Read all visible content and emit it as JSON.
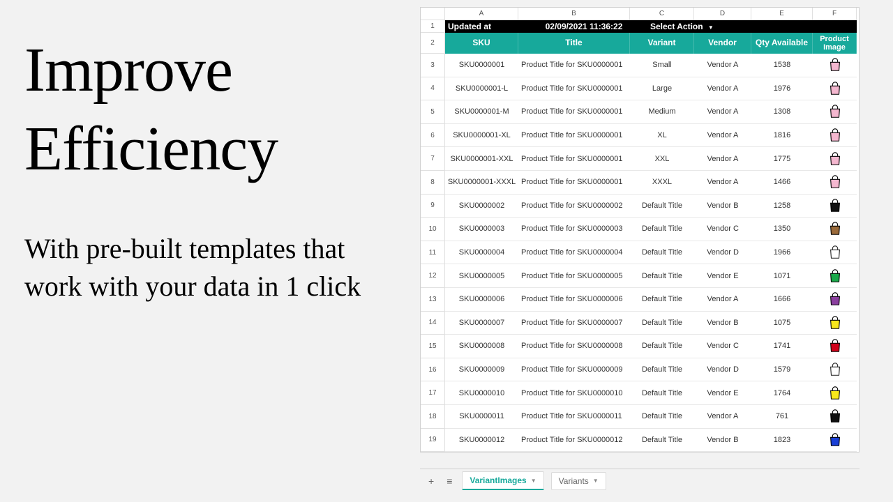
{
  "left": {
    "headline_l1": "Improve",
    "headline_l2": "Efficiency",
    "subhead": "With pre-built templates that work with your data in 1 click"
  },
  "blackbar": {
    "updated_label": "Updated at",
    "timestamp": "02/09/2021 11:36:22",
    "action_label": "Select Action"
  },
  "col_letters": [
    "",
    "A",
    "B",
    "C",
    "D",
    "E",
    "F"
  ],
  "headers": [
    "SKU",
    "Title",
    "Variant",
    "Vendor",
    "Qty Available",
    "Product Image"
  ],
  "rows": [
    {
      "n": 3,
      "sku": "SKU0000001",
      "title": "Product Title for SKU0000001",
      "variant": "Small",
      "vendor": "Vendor A",
      "qty": "1538",
      "bag": "#f4b7cf"
    },
    {
      "n": 4,
      "sku": "SKU0000001-L",
      "title": "Product Title for SKU0000001",
      "variant": "Large",
      "vendor": "Vendor A",
      "qty": "1976",
      "bag": "#f4b7cf"
    },
    {
      "n": 5,
      "sku": "SKU0000001-M",
      "title": "Product Title for SKU0000001",
      "variant": "Medium",
      "vendor": "Vendor A",
      "qty": "1308",
      "bag": "#f4b7cf"
    },
    {
      "n": 6,
      "sku": "SKU0000001-XL",
      "title": "Product Title for SKU0000001",
      "variant": "XL",
      "vendor": "Vendor A",
      "qty": "1816",
      "bag": "#f4b7cf"
    },
    {
      "n": 7,
      "sku": "SKU0000001-XXL",
      "title": "Product Title for SKU0000001",
      "variant": "XXL",
      "vendor": "Vendor A",
      "qty": "1775",
      "bag": "#f4b7cf"
    },
    {
      "n": 8,
      "sku": "SKU0000001-XXXL",
      "title": "Product Title for SKU0000001",
      "variant": "XXXL",
      "vendor": "Vendor A",
      "qty": "1466",
      "bag": "#f4b7cf"
    },
    {
      "n": 9,
      "sku": "SKU0000002",
      "title": "Product Title for SKU0000002",
      "variant": "Default Title",
      "vendor": "Vendor B",
      "qty": "1258",
      "bag": "#111111"
    },
    {
      "n": 10,
      "sku": "SKU0000003",
      "title": "Product Title for SKU0000003",
      "variant": "Default Title",
      "vendor": "Vendor C",
      "qty": "1350",
      "bag": "#9a6a3a"
    },
    {
      "n": 11,
      "sku": "SKU0000004",
      "title": "Product Title for SKU0000004",
      "variant": "Default Title",
      "vendor": "Vendor D",
      "qty": "1966",
      "bag": "#ffffff"
    },
    {
      "n": 12,
      "sku": "SKU0000005",
      "title": "Product Title for SKU0000005",
      "variant": "Default Title",
      "vendor": "Vendor E",
      "qty": "1071",
      "bag": "#1ba84a"
    },
    {
      "n": 13,
      "sku": "SKU0000006",
      "title": "Product Title for SKU0000006",
      "variant": "Default Title",
      "vendor": "Vendor A",
      "qty": "1666",
      "bag": "#8a3f9e"
    },
    {
      "n": 14,
      "sku": "SKU0000007",
      "title": "Product Title for SKU0000007",
      "variant": "Default Title",
      "vendor": "Vendor B",
      "qty": "1075",
      "bag": "#f8e81c"
    },
    {
      "n": 15,
      "sku": "SKU0000008",
      "title": "Product Title for SKU0000008",
      "variant": "Default Title",
      "vendor": "Vendor C",
      "qty": "1741",
      "bag": "#d0021b"
    },
    {
      "n": 16,
      "sku": "SKU0000009",
      "title": "Product Title for SKU0000009",
      "variant": "Default Title",
      "vendor": "Vendor D",
      "qty": "1579",
      "bag": "#ffffff"
    },
    {
      "n": 17,
      "sku": "SKU0000010",
      "title": "Product Title for SKU0000010",
      "variant": "Default Title",
      "vendor": "Vendor E",
      "qty": "1764",
      "bag": "#f8e81c"
    },
    {
      "n": 18,
      "sku": "SKU0000011",
      "title": "Product Title for SKU0000011",
      "variant": "Default Title",
      "vendor": "Vendor A",
      "qty": "761",
      "bag": "#111111"
    },
    {
      "n": 19,
      "sku": "SKU0000012",
      "title": "Product Title for SKU0000012",
      "variant": "Default Title",
      "vendor": "Vendor B",
      "qty": "1823",
      "bag": "#1a3fd6"
    }
  ],
  "tabs": {
    "add_icon": "+",
    "list_icon": "≡",
    "active": "VariantImages",
    "other": "Variants"
  }
}
